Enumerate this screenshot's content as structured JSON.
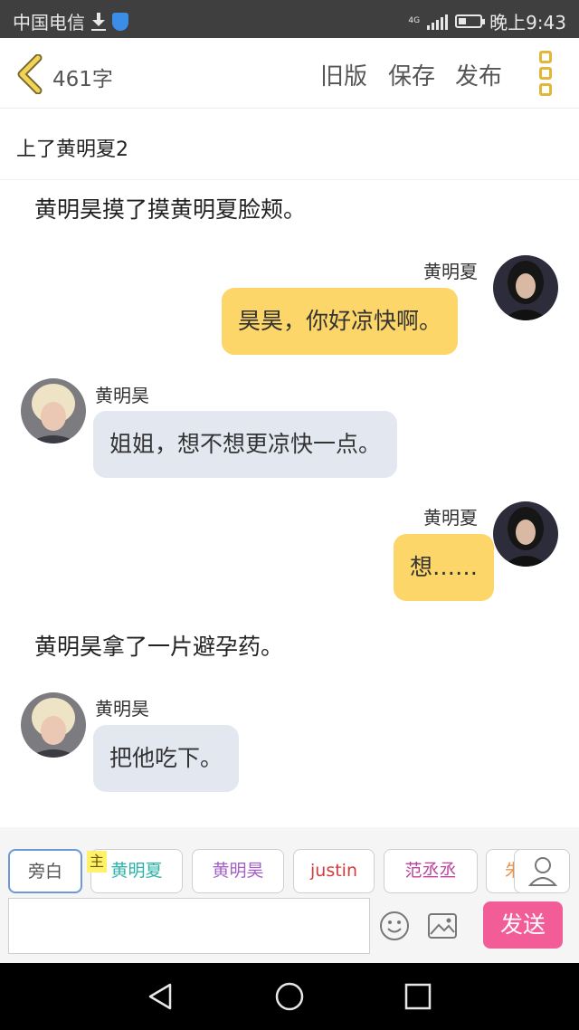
{
  "statusbar": {
    "carrier": "中国电信",
    "network": "4G",
    "time": "晚上9:43"
  },
  "header": {
    "word_count": "461字",
    "old_version": "旧版",
    "save": "保存",
    "publish": "发布"
  },
  "chapter": {
    "title": "上了黄明夏2"
  },
  "messages": [
    {
      "type": "narration",
      "text": "黄明昊摸了摸黄明夏脸颊。"
    },
    {
      "type": "right",
      "sender": "黄明夏",
      "text": "昊昊，你好凉快啊。"
    },
    {
      "type": "left",
      "sender": "黄明昊",
      "text": "姐姐，想不想更凉快一点。"
    },
    {
      "type": "right",
      "sender": "黄明夏",
      "text": "想……"
    },
    {
      "type": "narration",
      "text": "黄明昊拿了一片避孕药。"
    },
    {
      "type": "left",
      "sender": "黄明昊",
      "text": "把他吃下。"
    }
  ],
  "characters": {
    "narrator": "旁白",
    "main_badge": "主",
    "items": [
      {
        "name": "黄明夏",
        "color": "#2bb3a8"
      },
      {
        "name": "黄明昊",
        "color": "#a35fc7"
      },
      {
        "name": "justin",
        "color": "#d43b3b"
      },
      {
        "name": "范丞丞",
        "color": "#c13f9c"
      },
      {
        "name": "朱",
        "color": "#e8944a"
      }
    ]
  },
  "composer": {
    "input_value": "",
    "send": "发送"
  },
  "colors": {
    "accent": "#e2b63a",
    "my_bubble": "#fcd668",
    "other_bubble": "#e3e8f0",
    "send_button": "#f25d98"
  },
  "icons": [
    "back-icon",
    "menu-icon",
    "emoji-icon",
    "image-icon",
    "user-icon",
    "nav-back-icon",
    "nav-home-icon",
    "nav-recents-icon"
  ]
}
